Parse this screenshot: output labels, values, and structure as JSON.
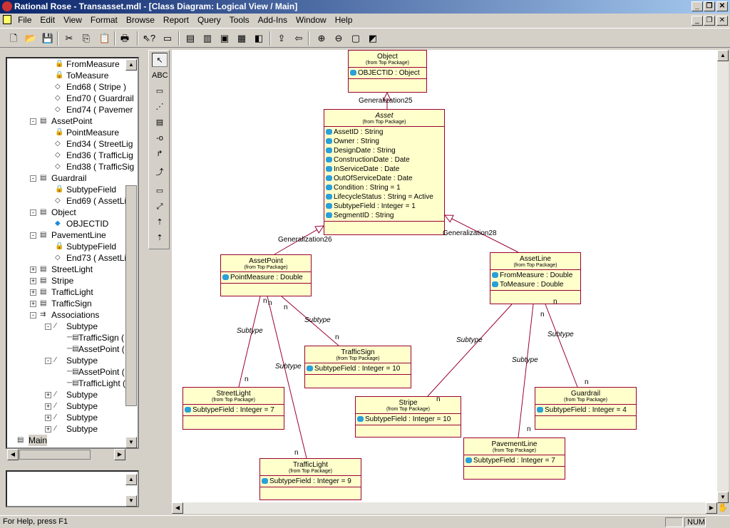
{
  "window": {
    "title": "Rational Rose - Transasset.mdl - [Class Diagram: Logical View / Main]"
  },
  "menu": [
    "File",
    "Edit",
    "View",
    "Format",
    "Browse",
    "Report",
    "Query",
    "Tools",
    "Add-Ins",
    "Window",
    "Help"
  ],
  "toolbar": [
    {
      "name": "new-icon",
      "glyph": "🗋"
    },
    {
      "name": "open-icon",
      "glyph": "📂"
    },
    {
      "name": "save-icon",
      "glyph": "💾"
    },
    {
      "name": "cut-icon",
      "glyph": "✂"
    },
    {
      "name": "copy-icon",
      "glyph": "⎘"
    },
    {
      "name": "paste-icon",
      "glyph": "📋"
    },
    {
      "name": "print-icon",
      "glyph": "🖶"
    },
    {
      "name": "context-help-icon",
      "glyph": "⇖?"
    },
    {
      "name": "view-documentation-icon",
      "glyph": "▭"
    },
    {
      "name": "browse-class-diagram-icon",
      "glyph": "▤"
    },
    {
      "name": "browse-interaction-diagram-icon",
      "glyph": "▥"
    },
    {
      "name": "browse-component-diagram-icon",
      "glyph": "▣"
    },
    {
      "name": "browse-state-diagram-icon",
      "glyph": "▦"
    },
    {
      "name": "browse-deployment-diagram-icon",
      "glyph": "◧"
    },
    {
      "name": "browse-parent-icon",
      "glyph": "⇪"
    },
    {
      "name": "browse-previous-icon",
      "glyph": "⇦"
    },
    {
      "name": "zoom-in-icon",
      "glyph": "⊕"
    },
    {
      "name": "zoom-out-icon",
      "glyph": "⊖"
    },
    {
      "name": "fit-in-window-icon",
      "glyph": "▢"
    },
    {
      "name": "undo-fit-icon",
      "glyph": "◩"
    }
  ],
  "tree": [
    {
      "lvl": 2,
      "icon": "attr",
      "label": "FromMeasure"
    },
    {
      "lvl": 2,
      "icon": "role",
      "label": "ToMeasure",
      "iconOverride": "attr"
    },
    {
      "lvl": 2,
      "icon": "role",
      "label": "End68 ( Stripe )"
    },
    {
      "lvl": 2,
      "icon": "role",
      "label": "End70 ( Guardrail"
    },
    {
      "lvl": 2,
      "icon": "role",
      "label": "End74 ( Pavemer"
    },
    {
      "lvl": 1,
      "icon": "class",
      "exp": "-",
      "label": "AssetPoint"
    },
    {
      "lvl": 2,
      "icon": "attr",
      "label": "PointMeasure"
    },
    {
      "lvl": 2,
      "icon": "role",
      "label": "End34 ( StreetLig"
    },
    {
      "lvl": 2,
      "icon": "role",
      "label": "End36 ( TrafficLig"
    },
    {
      "lvl": 2,
      "icon": "role",
      "label": "End38 ( TrafficSig"
    },
    {
      "lvl": 1,
      "icon": "class",
      "exp": "-",
      "label": "Guardrail"
    },
    {
      "lvl": 2,
      "icon": "attr",
      "label": "SubtypeField"
    },
    {
      "lvl": 2,
      "icon": "role",
      "label": "End69 ( AssetLine"
    },
    {
      "lvl": 1,
      "icon": "class",
      "exp": "-",
      "label": "Object"
    },
    {
      "lvl": 2,
      "icon": "oid",
      "label": "OBJECTID"
    },
    {
      "lvl": 1,
      "icon": "class",
      "exp": "-",
      "label": "PavementLine"
    },
    {
      "lvl": 2,
      "icon": "attr",
      "label": "SubtypeField"
    },
    {
      "lvl": 2,
      "icon": "role",
      "label": "End73 ( AssetLine"
    },
    {
      "lvl": 1,
      "icon": "class",
      "exp": "+",
      "label": "StreetLight"
    },
    {
      "lvl": 1,
      "icon": "class",
      "exp": "+",
      "label": "Stripe"
    },
    {
      "lvl": 1,
      "icon": "class",
      "exp": "+",
      "label": "TrafficLight"
    },
    {
      "lvl": 1,
      "icon": "class",
      "exp": "+",
      "label": "TrafficSign"
    },
    {
      "lvl": 1,
      "icon": "assocs",
      "exp": "-",
      "label": "Associations"
    },
    {
      "lvl": 2,
      "icon": "assoc",
      "exp": "-",
      "label": "Subtype"
    },
    {
      "lvl": 3,
      "icon": "end",
      "label": "TrafficSign ( E"
    },
    {
      "lvl": 3,
      "icon": "end",
      "label": "AssetPoint ( E"
    },
    {
      "lvl": 2,
      "icon": "assoc",
      "exp": "-",
      "label": "Subtype"
    },
    {
      "lvl": 3,
      "icon": "end",
      "label": "AssetPoint ( E"
    },
    {
      "lvl": 3,
      "icon": "end",
      "label": "TrafficLight ( I"
    },
    {
      "lvl": 2,
      "icon": "assoc",
      "exp": "+",
      "label": "Subtype"
    },
    {
      "lvl": 2,
      "icon": "assoc",
      "exp": "+",
      "label": "Subtype"
    },
    {
      "lvl": 2,
      "icon": "assoc",
      "exp": "+",
      "label": "Subtype"
    },
    {
      "lvl": 2,
      "icon": "assoc",
      "exp": "+",
      "label": "Subtype"
    },
    {
      "lvl": 0,
      "icon": "diagram",
      "label": "Main",
      "selected": true
    }
  ],
  "tools": [
    {
      "name": "selection-tool-icon",
      "glyph": "↖"
    },
    {
      "name": "text-tool-icon",
      "glyph": "ABC"
    },
    {
      "name": "note-tool-icon",
      "glyph": "▭"
    },
    {
      "name": "anchor-note-tool-icon",
      "glyph": "⋰"
    },
    {
      "name": "class-tool-icon",
      "glyph": "▤"
    },
    {
      "name": "interface-tool-icon",
      "glyph": "-o"
    },
    {
      "name": "association-tool-icon",
      "glyph": "↱"
    },
    {
      "name": "unidirectional-association-tool-icon",
      "glyph": "⤴"
    },
    {
      "name": "package-tool-icon",
      "glyph": "▭"
    },
    {
      "name": "dependency-tool-icon",
      "glyph": "⤢"
    },
    {
      "name": "generalization-tool-icon",
      "glyph": "⇡"
    },
    {
      "name": "realize-tool-icon",
      "glyph": "⇡"
    }
  ],
  "classes": [
    {
      "id": "object",
      "name": "Object",
      "from": "(from Top Package)",
      "attrs": [
        "OBJECTID : Object"
      ]
    },
    {
      "id": "asset",
      "name": "Asset",
      "italic": true,
      "from": "(from Top Package)",
      "attrs": [
        "AssetID : String",
        "Owner : String",
        "DesignDate : String",
        "ConstructionDate : Date",
        "InServiceDate : Date",
        "OutOfServiceDate : Date",
        "Condition : String = 1",
        "LifecycleStatus : String = Active",
        "SubtypeField : Integer = 1",
        "SegmentID : String"
      ]
    },
    {
      "id": "assetpoint",
      "name": "AssetPoint",
      "from": "(from Top Package)",
      "attrs": [
        "PointMeasure : Double"
      ]
    },
    {
      "id": "assetline",
      "name": "AssetLine",
      "from": "(from Top Package)",
      "attrs": [
        "FromMeasure : Double",
        "ToMeasure : Double"
      ]
    },
    {
      "id": "trafficsign",
      "name": "TrafficSign",
      "from": "(from Top Package)",
      "attrs": [
        "SubtypeField : Integer = 10"
      ]
    },
    {
      "id": "streetlight",
      "name": "StreetLight",
      "from": "(from Top Package)",
      "attrs": [
        "SubtypeField : Integer = 7"
      ]
    },
    {
      "id": "stripe",
      "name": "Stripe",
      "from": "(from Top Package)",
      "attrs": [
        "SubtypeField : Integer = 10"
      ]
    },
    {
      "id": "guardrail",
      "name": "Guardrail",
      "from": "(from Top Package)",
      "attrs": [
        "SubtypeField : Integer = 4"
      ]
    },
    {
      "id": "pavementline",
      "name": "PavementLine",
      "from": "(from Top Package)",
      "attrs": [
        "SubtypeField : Integer = 7"
      ]
    },
    {
      "id": "trafficlight",
      "name": "TrafficLight",
      "from": "(from Top Package)",
      "attrs": [
        "SubtypeField : Integer = 9"
      ]
    }
  ],
  "generalizations": [
    "Generalization25",
    "Generalization26",
    "Generalization28"
  ],
  "association_label": "Subtype",
  "multiplicity": "n",
  "status": {
    "help": "For Help, press F1",
    "num": "NUM"
  },
  "colors": {
    "class_fill": "#ffffcc",
    "class_border": "#990033",
    "line": "#990033"
  }
}
